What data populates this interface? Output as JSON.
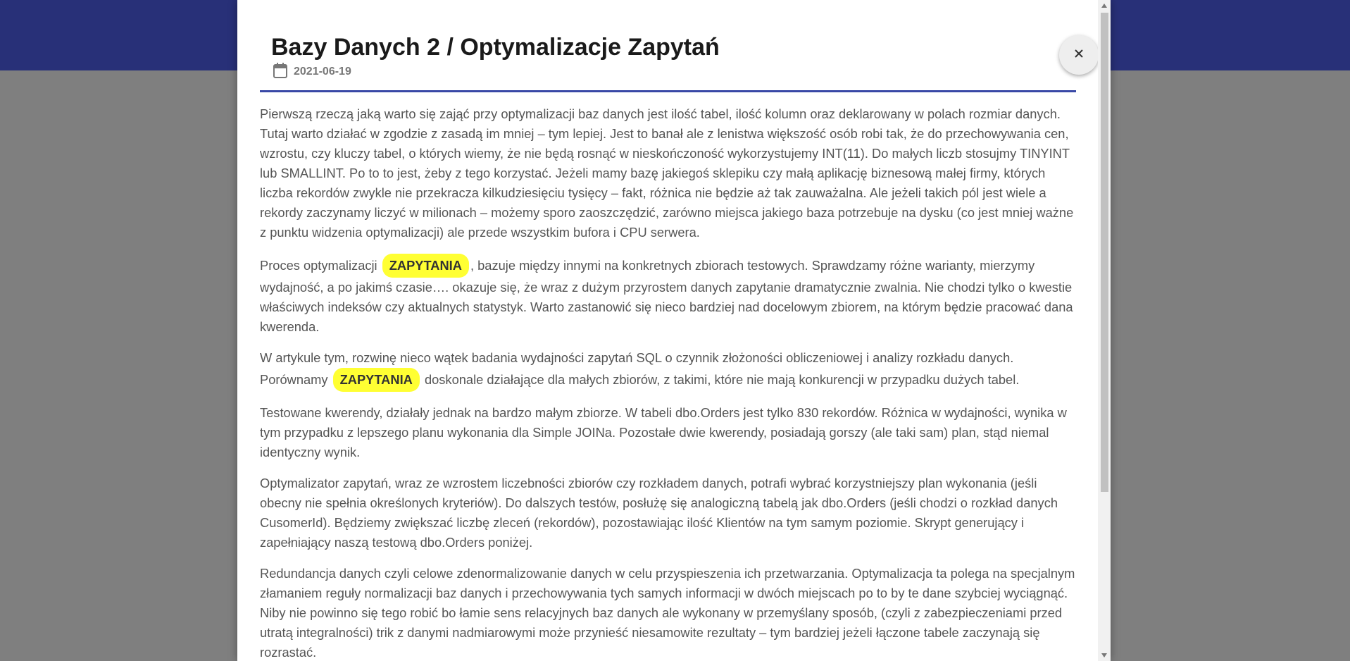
{
  "dialog": {
    "title": "Bazy Danych 2 / Optymalizacje Zapytań",
    "date": "2021-06-19",
    "close_label": "×"
  },
  "article": {
    "p1": "Pierwszą rzeczą jaką warto się zająć przy optymalizacji baz danych jest ilość tabel, ilość kolumn oraz deklarowany w polach rozmiar danych. Tutaj warto działać w zgodzie z zasadą im mniej – tym lepiej. Jest to banał ale z lenistwa większość osób robi tak, że do przechowywania cen, wzrostu, czy kluczy tabel, o których wiemy, że nie będą rosnąć w nieskończoność wykorzystujemy INT(11). Do małych liczb stosujmy TINYINT lub SMALLINT. Po to to jest, żeby z tego korzystać. Jeżeli mamy bazę jakiegoś sklepiku czy małą aplikację biznesową małej firmy, których liczba rekordów zwykle nie przekracza kilkudziesięciu tysięcy – fakt, różnica nie będzie aż tak zauważalna. Ale jeżeli takich pól jest wiele a rekordy zaczynamy liczyć w milionach – możemy sporo zaoszczędzić, zarówno miejsca jakiego baza potrzebuje na dysku (co jest mniej ważne z punktu widzenia optymalizacji) ale przede wszystkim bufora i CPU serwera.",
    "p2_before": "Proces optymalizacji ",
    "p2_chip": "ZAPYTANIA",
    "p2_after": ", bazuje między innymi na konkretnych zbiorach testowych. Sprawdzamy różne warianty, mierzymy wydajność, a po jakimś czasie…. okazuje się, że wraz z dużym przyrostem danych zapytanie dramatycznie zwalnia. Nie chodzi tylko o kwestie właściwych indeksów czy aktualnych statystyk. Warto zastanowić się nieco bardziej nad docelowym zbiorem, na którym będzie pracować dana kwerenda.",
    "p3_before": "W artykule tym, rozwinę nieco wątek badania wydajności zapytań SQL o czynnik złożoności obliczeniowej i analizy rozkładu danych. Porównamy ",
    "p3_chip": "ZAPYTANIA",
    "p3_after": " doskonale działające dla małych zbiorów, z takimi, które nie mają konkurencji w przypadku dużych tabel.",
    "p4": "Testowane kwerendy, działały jednak na bardzo małym zbiorze. W tabeli dbo.Orders jest tylko 830 rekordów. Różnica w wydajności, wynika w tym przypadku z lepszego planu wykonania dla Simple JOINa. Pozostałe dwie kwerendy, posiadają gorszy (ale taki sam) plan, stąd niemal identyczny wynik.",
    "p5": "Optymalizator zapytań, wraz ze wzrostem liczebności zbiorów czy rozkładem danych, potrafi wybrać korzystniejszy plan wykonania (jeśli obecny nie spełnia określonych kryteriów). Do dalszych testów, posłużę się analogiczną tabelą jak dbo.Orders (jeśli chodzi o rozkład danych CusomerId). Będziemy zwiększać liczbę zleceń (rekordów), pozostawiając ilość Klientów na tym samym poziomie. Skrypt generujący i zapełniający naszą testową dbo.Orders poniżej.",
    "p6": "Redundancja danych czyli celowe zdenormalizowanie danych w celu przyspieszenia ich przetwarzania. Optymalizacja ta polega na specjalnym złamaniem reguły normalizacji baz danych i przechowywania tych samych informacji w dwóch miejscach po to by te dane szybciej wyciągnąć. Niby nie powinno się tego robić bo łamie sens relacyjnych baz danych ale wykonany w przemyślany sposób, (czyli z zabezpieczeniami przed utratą integralności) trik z danymi nadmiarowymi może przynieść niesamowite rezultaty – tym bardziej jeżeli łączone tabele zaczynają się rozrastać."
  },
  "colors": {
    "header": "#283078",
    "divider": "#3948a6",
    "chip": "#ffff33"
  },
  "icons": {
    "date": "calendar-icon",
    "close": "close-icon"
  }
}
